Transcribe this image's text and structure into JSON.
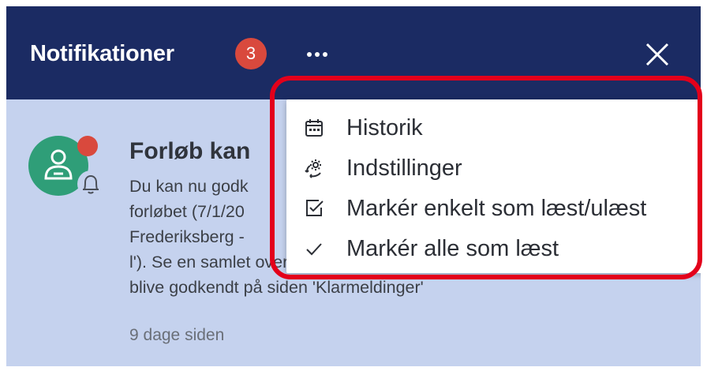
{
  "header": {
    "title": "Notifikationer",
    "badge_count": "3",
    "more_icon": "ellipsis-icon",
    "close_icon": "close-icon",
    "background": "#1b2b63"
  },
  "notification": {
    "title": "Forløb kan",
    "body_lines": [
      "Du kan nu godk",
      "forløbet (7/1/20",
      "Frederiksberg -",
      "l'). Se en samlet oversigt over forløb, der er klar til at",
      "blive godkendt på siden 'Klarmeldinger'"
    ],
    "time": "9 dage siden",
    "avatar_icon": "person-icon",
    "status_icon": "bell-icon",
    "unread": true
  },
  "menu": {
    "items": [
      {
        "label": "Historik",
        "icon": "calendar-icon"
      },
      {
        "label": "Indstillinger",
        "icon": "settings-icon"
      },
      {
        "label": "Markér enkelt som læst/ulæst",
        "icon": "checkbox-icon"
      },
      {
        "label": "Markér alle som læst",
        "icon": "checkmark-icon"
      }
    ]
  },
  "colors": {
    "panel_background": "#c5d2ee",
    "badge": "#d9493d",
    "avatar": "#2f9e78",
    "highlight_outline": "#e3001b"
  }
}
